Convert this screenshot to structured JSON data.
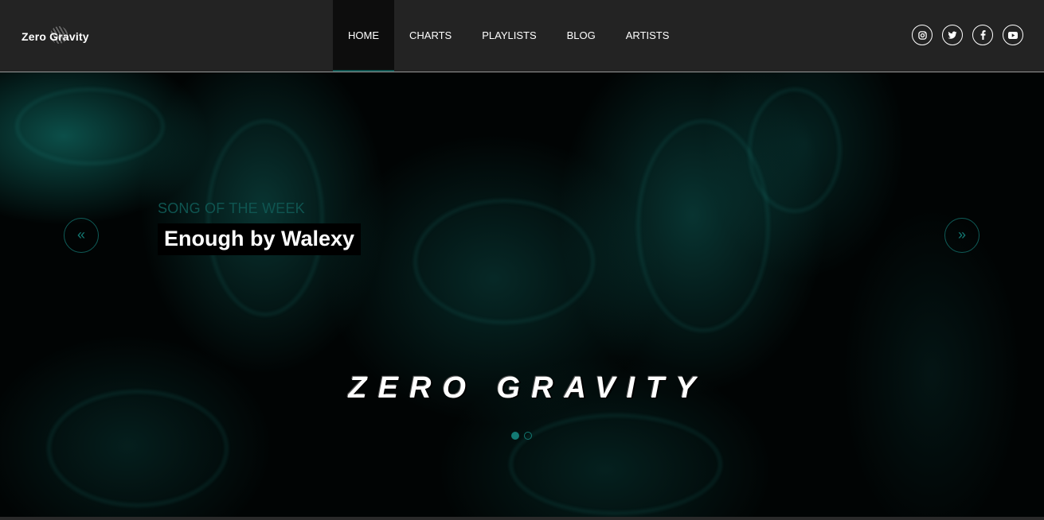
{
  "header": {
    "logo_word1": "Zero",
    "logo_word2": "Gravity",
    "nav": [
      {
        "label": "HOME",
        "active": true
      },
      {
        "label": "CHARTS",
        "active": false
      },
      {
        "label": "PLAYLISTS",
        "active": false
      },
      {
        "label": "BLOG",
        "active": false
      },
      {
        "label": "ARTISTS",
        "active": false
      }
    ],
    "socials": [
      "instagram-icon",
      "twitter-icon",
      "facebook-icon",
      "youtube-icon"
    ]
  },
  "hero": {
    "kicker": "SONG OF THE WEEK",
    "headline": "Enough by Walexy",
    "brand_title": "ZERO GRAVITY",
    "prev_arrow": "«",
    "next_arrow": "»",
    "slides": [
      {
        "active": true
      },
      {
        "active": false
      }
    ]
  },
  "colors": {
    "accent": "#137a74",
    "header_bg": "#232323",
    "active_nav_bg": "#0d0d0d",
    "kicker": "#0f5551"
  }
}
